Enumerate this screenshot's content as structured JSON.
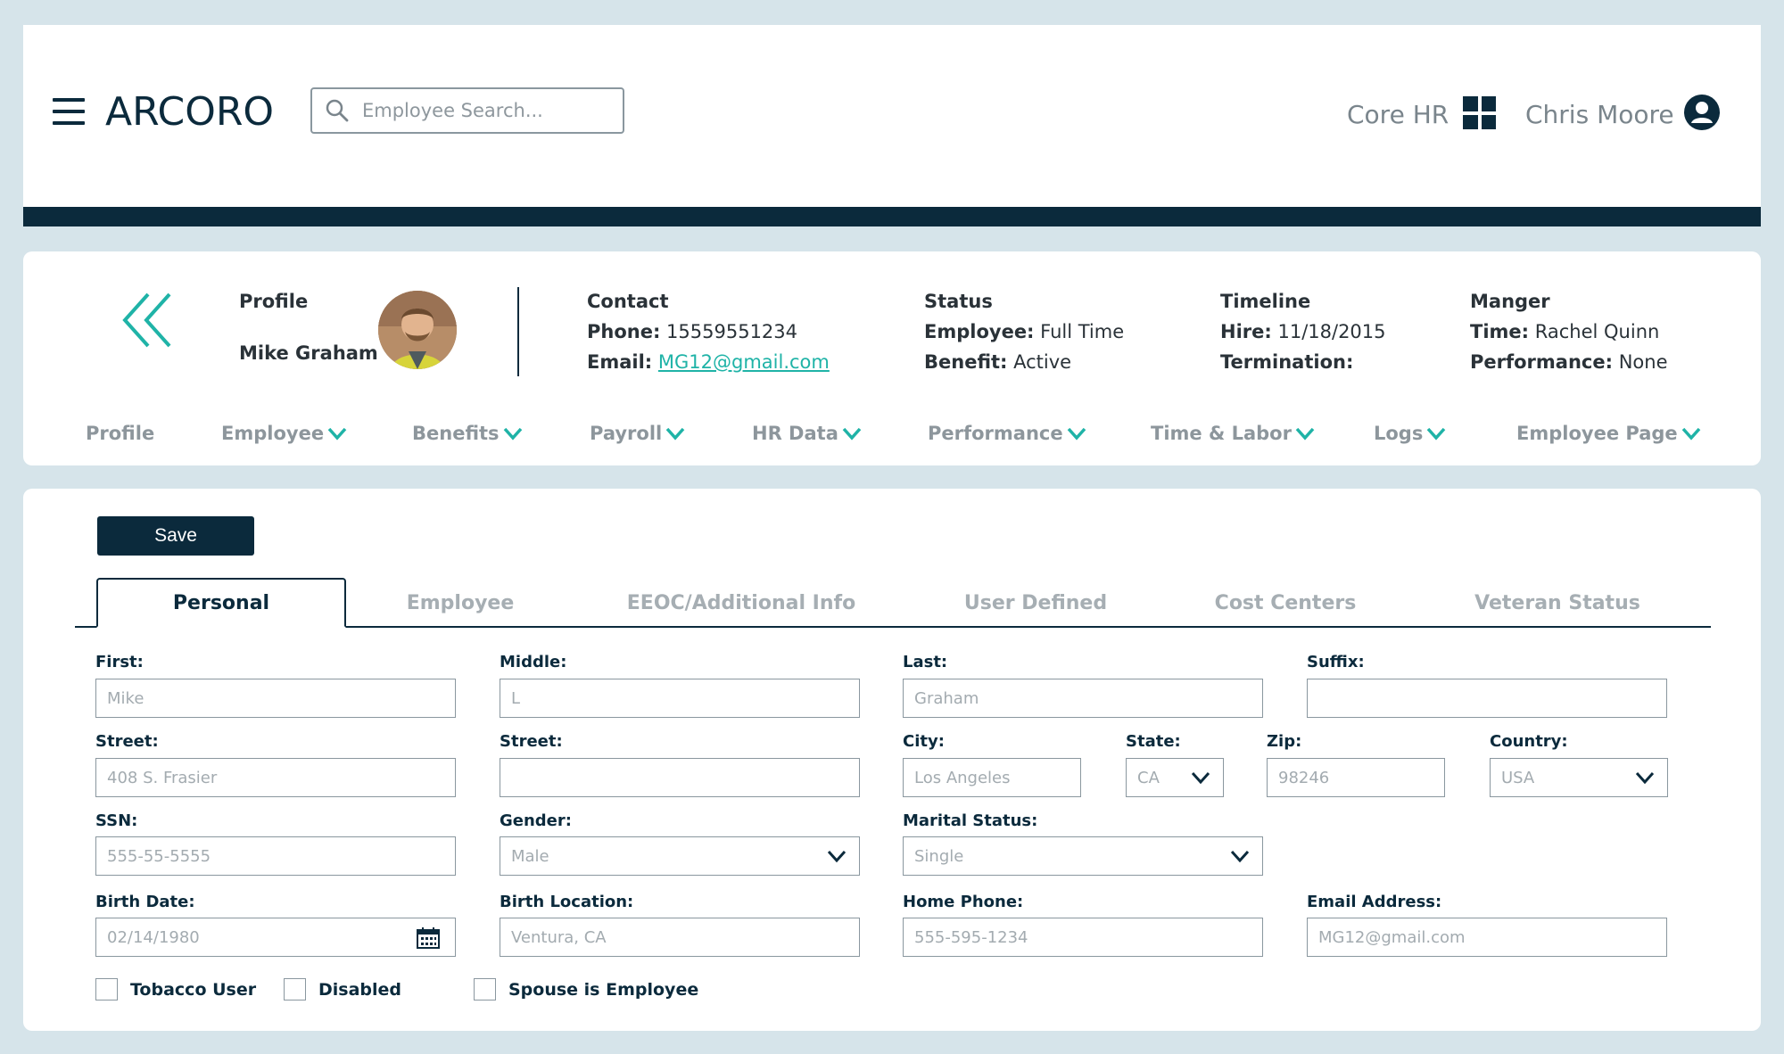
{
  "header": {
    "logo_text": "ARCORO",
    "search_placeholder": "Employee Search...",
    "module_label": "Core HR",
    "user_name": "Chris Moore"
  },
  "profile": {
    "section_label": "Profile",
    "name": "Mike Graham",
    "contact": {
      "title": "Contact",
      "phone_label": "Phone:",
      "phone": "15559551234",
      "email_label": "Email:",
      "email": "MG12@gmail.com"
    },
    "status": {
      "title": "Status",
      "employee_label": "Employee:",
      "employee": "Full Time",
      "benefit_label": "Benefit:",
      "benefit": "Active"
    },
    "timeline": {
      "title": "Timeline",
      "hire_label": "Hire:",
      "hire": "11/18/2015",
      "termination_label": "Termination:"
    },
    "manager": {
      "title": "Manger",
      "time_label": "Time:",
      "time": "Rachel Quinn",
      "performance_label": "Performance:",
      "performance": "None"
    },
    "nav": [
      "Profile",
      "Employee",
      "Benefits",
      "Payroll",
      "HR Data",
      "Performance",
      "Time & Labor",
      "Logs",
      "Employee Page"
    ]
  },
  "form": {
    "save_label": "Save",
    "tabs": [
      "Personal",
      "Employee",
      "EEOC/Additional Info",
      "User Defined",
      "Cost Centers",
      "Veteran Status"
    ],
    "active_tab": "Personal",
    "fields": {
      "first": {
        "label": "First:",
        "placeholder": "Mike"
      },
      "middle": {
        "label": "Middle:",
        "placeholder": "L"
      },
      "last": {
        "label": "Last:",
        "placeholder": "Graham"
      },
      "suffix": {
        "label": "Suffix:",
        "placeholder": ""
      },
      "street1": {
        "label": "Street:",
        "placeholder": "408 S. Frasier"
      },
      "street2": {
        "label": "Street:",
        "placeholder": ""
      },
      "city": {
        "label": "City:",
        "placeholder": "Los Angeles"
      },
      "state": {
        "label": "State:",
        "value": "CA"
      },
      "zip": {
        "label": "Zip:",
        "placeholder": "98246"
      },
      "country": {
        "label": "Country:",
        "value": "USA"
      },
      "ssn": {
        "label": "SSN:",
        "placeholder": "555-55-5555"
      },
      "gender": {
        "label": "Gender:",
        "value": "Male"
      },
      "marital": {
        "label": "Marital Status:",
        "value": "Single"
      },
      "birth_date": {
        "label": "Birth Date:",
        "placeholder": "02/14/1980"
      },
      "birth_location": {
        "label": "Birth Location:",
        "placeholder": "Ventura, CA"
      },
      "home_phone": {
        "label": "Home Phone:",
        "placeholder": "555-595-1234"
      },
      "email_address": {
        "label": "Email Address:",
        "placeholder": "MG12@gmail.com"
      }
    },
    "checkboxes": [
      "Tobacco User",
      "Disabled",
      "Spouse is Employee"
    ]
  },
  "colors": {
    "navy": "#0b2a3c",
    "teal": "#1fb3a7",
    "background": "#d6e4ea"
  }
}
